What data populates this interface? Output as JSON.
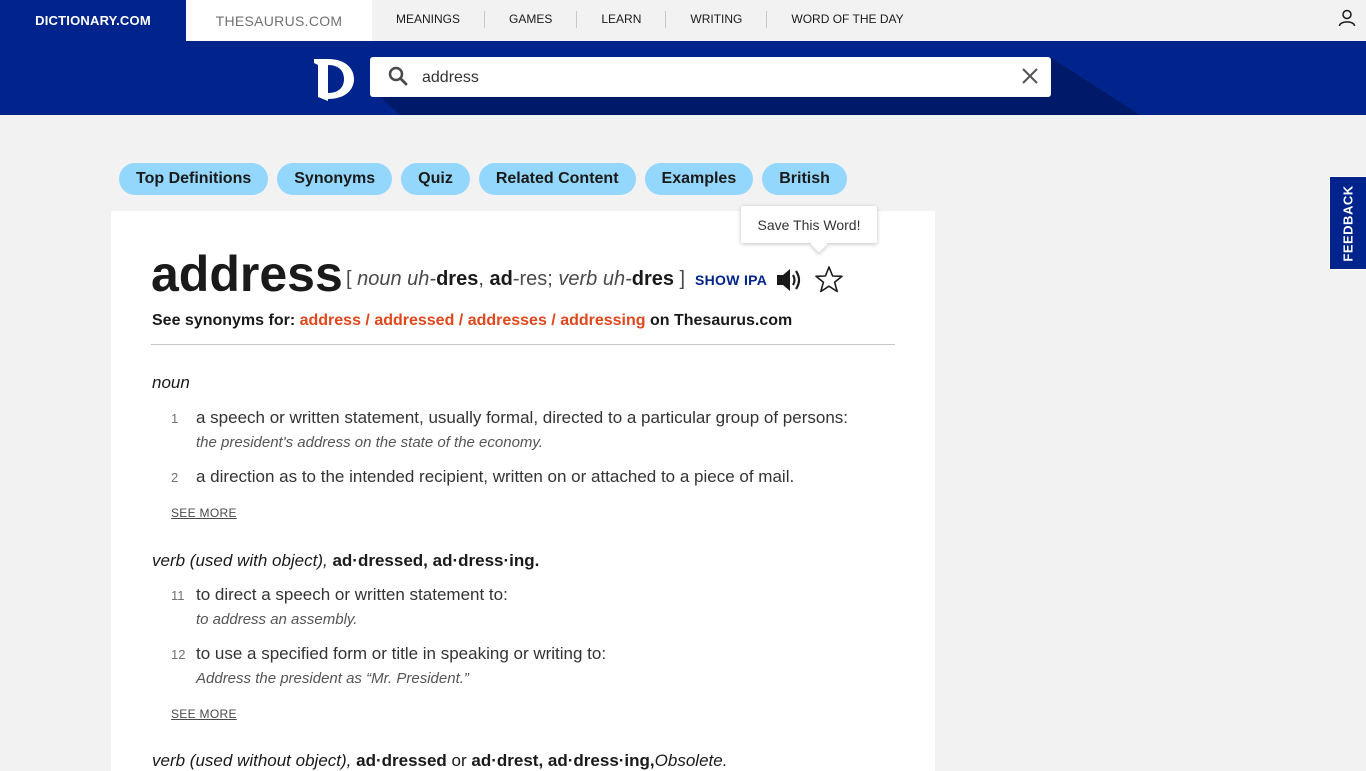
{
  "topnav": {
    "dictionary": "DICTIONARY.COM",
    "thesaurus": "THESAURUS.COM",
    "links": [
      "MEANINGS",
      "GAMES",
      "LEARN",
      "WRITING",
      "WORD OF THE DAY"
    ]
  },
  "search": {
    "value": "address"
  },
  "pills": [
    "Top Definitions",
    "Synonyms",
    "Quiz",
    "Related Content",
    "Examples",
    "British"
  ],
  "tooltip": "Save This Word!",
  "entry": {
    "headword": "address",
    "pron": {
      "open": "[ ",
      "noun_label": "noun",
      "noun_a": " uh-",
      "noun_b": "dres",
      "sep1": ", ",
      "alt_a": "ad",
      "alt_b": "-res; ",
      "verb_label": "verb",
      "verb_a": " uh-",
      "verb_b": "dres",
      "close": " ]"
    },
    "show_ipa": "SHOW IPA",
    "synonyms": {
      "prefix": "See synonyms for: ",
      "words": "address / addressed / addresses / addressing",
      "suffix": " on Thesaurus.com"
    }
  },
  "sections": {
    "noun": {
      "label": "noun",
      "defs": [
        {
          "num": "1",
          "text": "a speech or written statement, usually formal, directed to a particular group of persons:",
          "example": "the president's address on the state of the economy."
        },
        {
          "num": "2",
          "text": "a direction as to the intended recipient, written on or attached to a piece of mail.",
          "example": ""
        }
      ],
      "see_more": "SEE MORE"
    },
    "verb_obj": {
      "label": "verb (used with object),",
      "forms": " ad·dressed, ad·dress·ing.",
      "defs": [
        {
          "num": "11",
          "text": "to direct a speech or written statement to:",
          "example": "to address an assembly."
        },
        {
          "num": "12",
          "text": "to use a specified form or title in speaking or writing to:",
          "example": "Address the president as “Mr. President.”"
        }
      ],
      "see_more": "SEE MORE"
    },
    "verb_noobj": {
      "label": "verb (used without object),",
      "forms_a": " ad·dressed",
      "or": " or ",
      "forms_b": "ad·drest, ad·dress·ing,",
      "obsolete": "Obsolete."
    }
  },
  "feedback": "FEEDBACK",
  "colors": {
    "brand": "#00248b",
    "pill": "#94d7fc",
    "link_red": "#e0471c"
  }
}
